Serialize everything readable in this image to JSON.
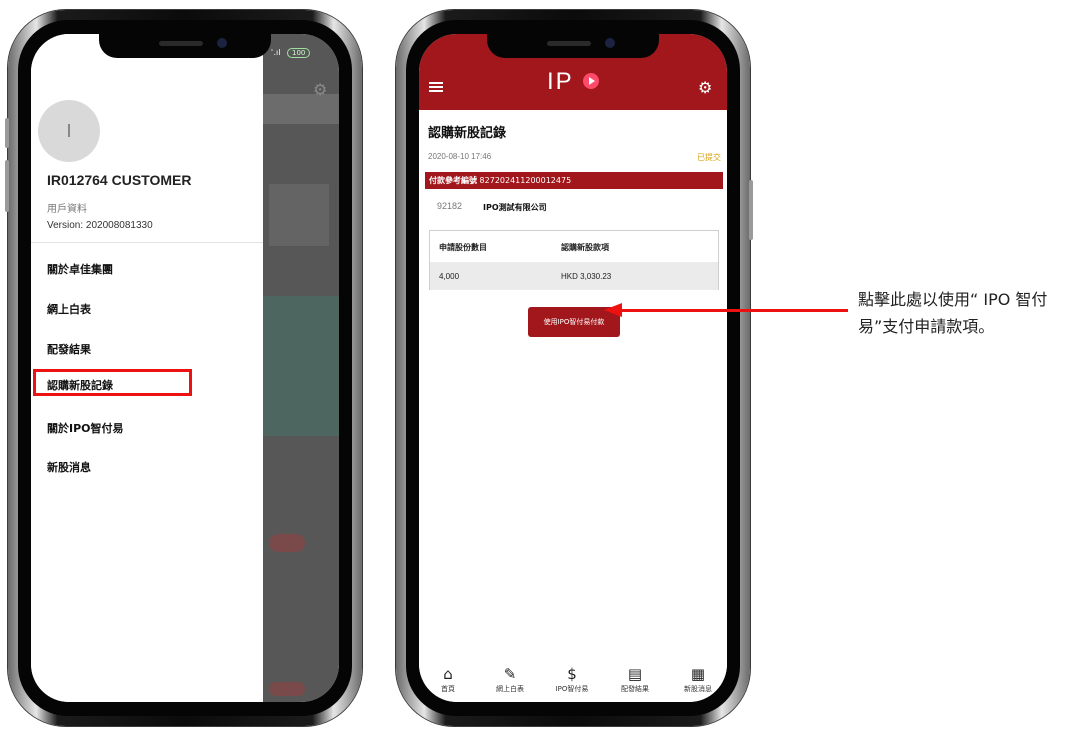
{
  "left_phone": {
    "status": {
      "signal": "ʿ.ıl",
      "battery": "100"
    },
    "drawer": {
      "avatar_initial": "I",
      "user_name": "IR012764 CUSTOMER",
      "profile_link": "用戶資料",
      "version": "Version: 202008081330",
      "items": [
        {
          "label": "關於卓佳集團"
        },
        {
          "label": "網上白表"
        },
        {
          "label": "配發結果"
        },
        {
          "label": "認購新股記錄",
          "highlighted": true
        },
        {
          "label": "關於IPO智付易"
        },
        {
          "label": "新股消息"
        }
      ]
    }
  },
  "right_phone": {
    "header": {
      "logo_text": "IP"
    },
    "page_title": "認購新股記錄",
    "record": {
      "datetime": "2020-08-10 17:46",
      "status": "已提交",
      "ref_label": "付款參考編號",
      "ref_value": "827202411200012475",
      "stock_code": "92182",
      "stock_name": "IPO測試有限公司"
    },
    "table": {
      "headers": [
        "申請股份數目",
        "認購新股款項"
      ],
      "rows": [
        [
          "4,000",
          "HKD 3,030.23"
        ]
      ]
    },
    "pay_button": "使用IPO智付易付款",
    "tabbar": [
      {
        "icon": "home-icon",
        "glyph": "⌂",
        "label": "首頁"
      },
      {
        "icon": "pencil-icon",
        "glyph": "✎",
        "label": "網上白表"
      },
      {
        "icon": "dollar-icon",
        "glyph": "$",
        "label": "IPO智付易"
      },
      {
        "icon": "clipboard-icon",
        "glyph": "▤",
        "label": "配發結果"
      },
      {
        "icon": "newspaper-icon",
        "glyph": "▦",
        "label": "新股消息"
      }
    ]
  },
  "annotation": {
    "text": "點擊此處以使用“ IPO 智付易”支付申請款項。"
  },
  "colors": {
    "brand_red": "#a2171b",
    "highlight_red": "#ee1111",
    "status_gold": "#d6a316"
  }
}
